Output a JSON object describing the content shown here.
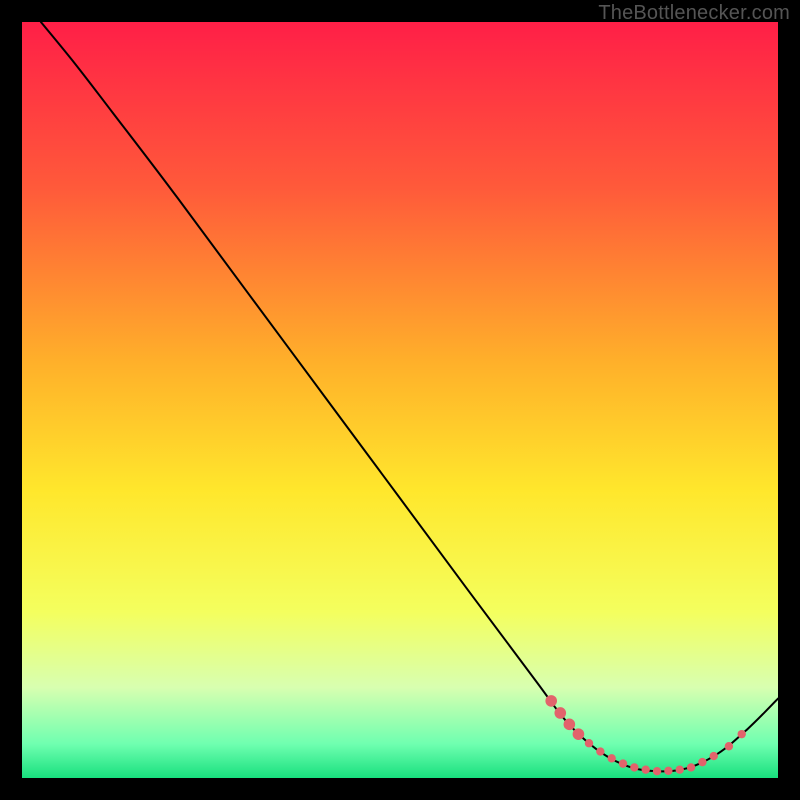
{
  "attribution": "TheBottlenecker.com",
  "chart_data": {
    "type": "line",
    "title": "",
    "xlabel": "",
    "ylabel": "",
    "xlim": [
      0,
      100
    ],
    "ylim": [
      0,
      100
    ],
    "background": {
      "type": "vertical-gradient",
      "stops": [
        {
          "offset": 0.0,
          "color": "#ff1f47"
        },
        {
          "offset": 0.22,
          "color": "#ff5a3a"
        },
        {
          "offset": 0.45,
          "color": "#ffb02a"
        },
        {
          "offset": 0.62,
          "color": "#ffe72c"
        },
        {
          "offset": 0.78,
          "color": "#f4ff5e"
        },
        {
          "offset": 0.88,
          "color": "#d8ffb0"
        },
        {
          "offset": 0.955,
          "color": "#6fffb0"
        },
        {
          "offset": 1.0,
          "color": "#18e07e"
        }
      ]
    },
    "series": [
      {
        "name": "curve",
        "color": "#000000",
        "stroke_width": 2,
        "points": [
          {
            "x": 2.5,
            "y": 100.0
          },
          {
            "x": 7.0,
            "y": 94.5
          },
          {
            "x": 12.0,
            "y": 88.0
          },
          {
            "x": 20.0,
            "y": 77.5
          },
          {
            "x": 30.0,
            "y": 64.0
          },
          {
            "x": 40.0,
            "y": 50.5
          },
          {
            "x": 50.0,
            "y": 37.0
          },
          {
            "x": 60.0,
            "y": 23.5
          },
          {
            "x": 68.0,
            "y": 12.8
          },
          {
            "x": 72.0,
            "y": 7.5
          },
          {
            "x": 76.0,
            "y": 3.8
          },
          {
            "x": 80.0,
            "y": 1.6
          },
          {
            "x": 84.0,
            "y": 0.9
          },
          {
            "x": 88.0,
            "y": 1.3
          },
          {
            "x": 92.0,
            "y": 3.2
          },
          {
            "x": 96.0,
            "y": 6.5
          },
          {
            "x": 100.0,
            "y": 10.5
          }
        ]
      }
    ],
    "markers": {
      "color": "#e2636b",
      "radius_small": 4.2,
      "radius_large": 5.8,
      "points": [
        {
          "x": 70.0,
          "y": 10.2,
          "r": "large"
        },
        {
          "x": 71.2,
          "y": 8.6,
          "r": "large"
        },
        {
          "x": 72.4,
          "y": 7.1,
          "r": "large"
        },
        {
          "x": 73.6,
          "y": 5.8,
          "r": "large"
        },
        {
          "x": 75.0,
          "y": 4.6,
          "r": "small"
        },
        {
          "x": 76.5,
          "y": 3.5,
          "r": "small"
        },
        {
          "x": 78.0,
          "y": 2.6,
          "r": "small"
        },
        {
          "x": 79.5,
          "y": 1.9,
          "r": "small"
        },
        {
          "x": 81.0,
          "y": 1.4,
          "r": "small"
        },
        {
          "x": 82.5,
          "y": 1.1,
          "r": "small"
        },
        {
          "x": 84.0,
          "y": 0.9,
          "r": "small"
        },
        {
          "x": 85.5,
          "y": 0.95,
          "r": "small"
        },
        {
          "x": 87.0,
          "y": 1.1,
          "r": "small"
        },
        {
          "x": 88.5,
          "y": 1.4,
          "r": "small"
        },
        {
          "x": 90.0,
          "y": 2.1,
          "r": "small"
        },
        {
          "x": 91.5,
          "y": 2.9,
          "r": "small"
        },
        {
          "x": 93.5,
          "y": 4.2,
          "r": "small"
        },
        {
          "x": 95.2,
          "y": 5.8,
          "r": "small"
        }
      ]
    }
  }
}
